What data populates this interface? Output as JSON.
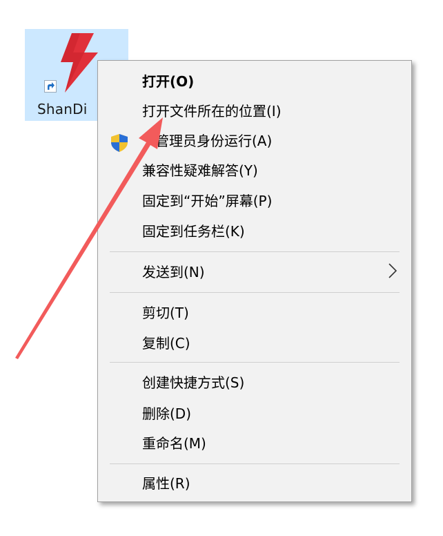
{
  "desktop": {
    "icon_label": "ShanDi",
    "icon_name": "shandian-app-icon",
    "brand_color": "#e0303a",
    "selection_color": "#cce8ff"
  },
  "context_menu": {
    "groups": [
      {
        "items": [
          {
            "label": "打开(O)",
            "bold": true
          },
          {
            "label": "打开文件所在的位置(I)"
          },
          {
            "label": "管理员身份运行(A)",
            "icon": "uac-shield-icon"
          },
          {
            "label": "兼容性疑难解答(Y)"
          },
          {
            "label": "固定到“开始”屏幕(P)"
          },
          {
            "label": "固定到任务栏(K)"
          }
        ]
      },
      {
        "items": [
          {
            "label": "发送到(N)",
            "submenu": true
          }
        ]
      },
      {
        "items": [
          {
            "label": "剪切(T)"
          },
          {
            "label": "复制(C)"
          }
        ]
      },
      {
        "items": [
          {
            "label": "创建快捷方式(S)"
          },
          {
            "label": "删除(D)"
          },
          {
            "label": "重命名(M)"
          }
        ]
      },
      {
        "items": [
          {
            "label": "属性(R)"
          }
        ]
      }
    ]
  },
  "annotation": {
    "type": "arrow",
    "color": "#f25b5b",
    "points_to": "打开文件所在的位置(I)"
  }
}
